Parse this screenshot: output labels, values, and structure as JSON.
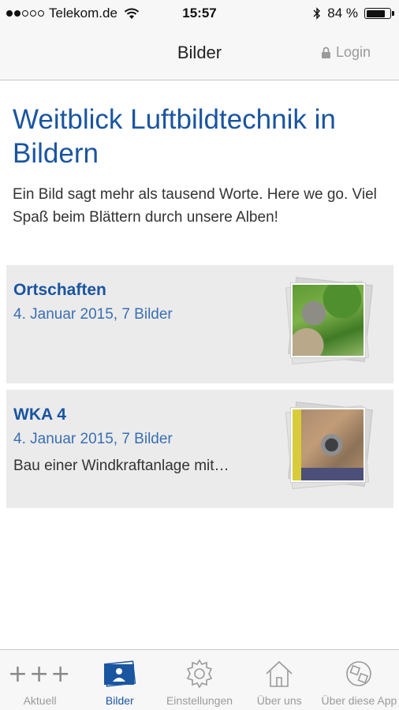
{
  "status_bar": {
    "carrier": "Telekom.de",
    "time": "15:57",
    "battery_percent": "84 %",
    "battery_level": 0.84
  },
  "nav": {
    "title": "Bilder",
    "login_label": "Login"
  },
  "main": {
    "title": "Weitblick Luftbildtechnik in Bildern",
    "intro": "Ein Bild sagt mehr als tausend Worte. Here we go. Viel Spaß beim Blättern durch unsere Alben!",
    "albums": [
      {
        "title": "Ortschaften",
        "meta": "4. Januar 2015, 7 Bilder",
        "description": ""
      },
      {
        "title": "WKA 4",
        "meta": "4. Januar 2015, 7 Bilder",
        "description": "Bau einer Windkraftanlage mit…"
      }
    ]
  },
  "tabs": [
    {
      "label": "Aktuell",
      "icon": "plus-icon",
      "active": false
    },
    {
      "label": "Bilder",
      "icon": "photo-album-icon",
      "active": true
    },
    {
      "label": "Einstellungen",
      "icon": "gear-icon",
      "active": false
    },
    {
      "label": "Über uns",
      "icon": "home-icon",
      "active": false
    },
    {
      "label": "Über diese App",
      "icon": "app-info-icon",
      "active": false
    }
  ],
  "colors": {
    "accent": "#1a55a0",
    "meta": "#3a6fb3",
    "inactive": "#9a9a9a",
    "card_bg": "#ebebeb"
  }
}
